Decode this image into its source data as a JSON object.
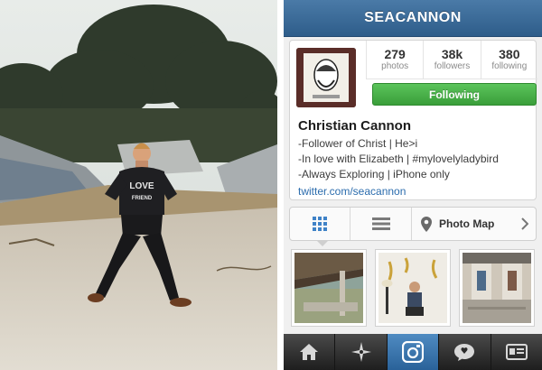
{
  "profile": {
    "username": "SEACANNON",
    "stats": [
      {
        "value": "279",
        "label": "photos"
      },
      {
        "value": "38k",
        "label": "followers"
      },
      {
        "value": "380",
        "label": "following"
      }
    ],
    "follow_button": "Following",
    "name": "Christian Cannon",
    "bio_lines": [
      "-Follower of Christ | He>i",
      "-In love with Elizabeth | #mylovelyladybird",
      "-Always Exploring | iPhone only"
    ],
    "link": "twitter.com/seacannon"
  },
  "view_tabs": {
    "grid_icon": "grid-view-icon",
    "list_icon": "list-view-icon",
    "map_icon": "map-pin-icon",
    "map_label": "Photo Map",
    "selected": "grid"
  },
  "photo_shirt_text": [
    "LOVE",
    "FRIEND"
  ],
  "bottom_tabs": [
    {
      "icon": "home-icon"
    },
    {
      "icon": "explore-icon"
    },
    {
      "icon": "camera-icon",
      "active": true
    },
    {
      "icon": "news-icon"
    },
    {
      "icon": "profile-icon"
    }
  ],
  "colors": {
    "navbar": "#3b6c9a",
    "follow_green": "#4cb04c",
    "link_blue": "#2b6cad",
    "active_tab": "#3d79b0"
  }
}
